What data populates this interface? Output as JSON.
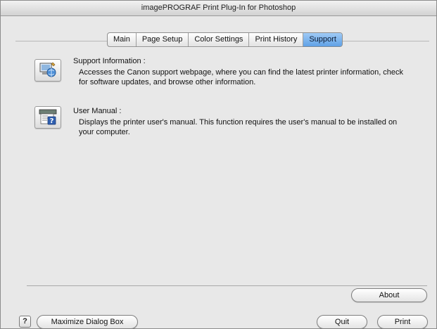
{
  "window": {
    "title": "imagePROGRAF Print Plug-In for Photoshop"
  },
  "tabs": [
    {
      "label": "Main",
      "active": false
    },
    {
      "label": "Page Setup",
      "active": false
    },
    {
      "label": "Color Settings",
      "active": false
    },
    {
      "label": "Print History",
      "active": false
    },
    {
      "label": "Support",
      "active": true
    }
  ],
  "support_items": [
    {
      "icon": "support-globe-icon",
      "title": "Support Information :",
      "description": "Accesses the Canon support webpage, where you can find the latest printer information, check for software updates, and browse other information."
    },
    {
      "icon": "user-manual-icon",
      "title": "User Manual :",
      "description": "Displays the printer user's manual. This function requires the user's manual to be installed on your computer."
    }
  ],
  "buttons": {
    "about": "About",
    "maximize": "Maximize Dialog Box",
    "quit": "Quit",
    "print": "Print",
    "help": "?"
  },
  "colors": {
    "active_tab": "#6aa8e8",
    "window_bg": "#e8e8e8"
  }
}
